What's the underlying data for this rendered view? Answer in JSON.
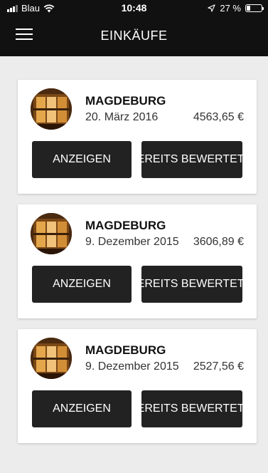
{
  "status_bar": {
    "carrier": "Blau",
    "time": "10:48",
    "battery": "27 %",
    "battery_level": 0.27
  },
  "header": {
    "title": "EINKÄUFE"
  },
  "icons": {
    "menu": "hamburger-menu-icon",
    "wifi": "wifi-icon",
    "location": "location-arrow-icon",
    "battery": "battery-icon"
  },
  "purchases": [
    {
      "store": "MAGDEBURG",
      "date": "20. März 2016",
      "amount": "4563,65 €",
      "show_label": "ANZEIGEN",
      "rated_label": "BEREITS BEWERTET"
    },
    {
      "store": "MAGDEBURG",
      "date": "9. Dezember 2015",
      "amount": "3606,89 €",
      "show_label": "ANZEIGEN",
      "rated_label": "BEREITS BEWERTET"
    },
    {
      "store": "MAGDEBURG",
      "date": "9. Dezember 2015",
      "amount": "2527,56 €",
      "show_label": "ANZEIGEN",
      "rated_label": "BEREITS BEWERTET"
    }
  ]
}
